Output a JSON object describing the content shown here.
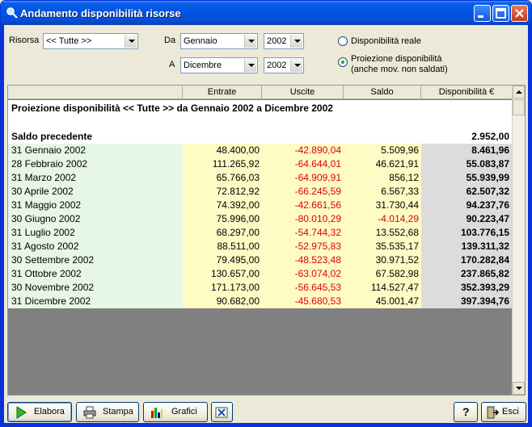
{
  "window": {
    "title": "Andamento disponibilità risorse"
  },
  "filters": {
    "risorsa_label": "Risorsa",
    "risorsa_value": "<< Tutte >>",
    "da_label": "Da",
    "da_month": "Gennaio",
    "da_year": "2002",
    "a_label": "A",
    "a_month": "Dicembre",
    "a_year": "2002",
    "radio_reale": "Disponibilità reale",
    "radio_proiezione_line1": "Proiezione disponibilità",
    "radio_proiezione_line2": "(anche mov. non saldati)",
    "selected": "proiezione"
  },
  "table": {
    "columns": [
      "Entrate",
      "Uscite",
      "Saldo",
      "Disponibilità €"
    ],
    "report_title": "Proiezione disponibilità << Tutte >> da Gennaio 2002 a Dicembre 2002",
    "prev_label": "Saldo precedente",
    "prev_value": "2.952,00",
    "rows": [
      {
        "date": "31 Gennaio 2002",
        "entrate": "48.400,00",
        "uscite": "-42.890,04",
        "saldo": "5.509,96",
        "disp": "8.461,96"
      },
      {
        "date": "28 Febbraio 2002",
        "entrate": "111.265,92",
        "uscite": "-64.644,01",
        "saldo": "46.621,91",
        "disp": "55.083,87"
      },
      {
        "date": "31 Marzo 2002",
        "entrate": "65.766,03",
        "uscite": "-64.909,91",
        "saldo": "856,12",
        "disp": "55.939,99"
      },
      {
        "date": "30 Aprile 2002",
        "entrate": "72.812,92",
        "uscite": "-66.245,59",
        "saldo": "6.567,33",
        "disp": "62.507,32"
      },
      {
        "date": "31 Maggio 2002",
        "entrate": "74.392,00",
        "uscite": "-42.661,56",
        "saldo": "31.730,44",
        "disp": "94.237,76"
      },
      {
        "date": "30 Giugno 2002",
        "entrate": "75.996,00",
        "uscite": "-80.010,29",
        "saldo": "-4.014,29",
        "disp": "90.223,47"
      },
      {
        "date": "31 Luglio 2002",
        "entrate": "68.297,00",
        "uscite": "-54.744,32",
        "saldo": "13.552,68",
        "disp": "103.776,15"
      },
      {
        "date": "31 Agosto 2002",
        "entrate": "88.511,00",
        "uscite": "-52.975,83",
        "saldo": "35.535,17",
        "disp": "139.311,32"
      },
      {
        "date": "30 Settembre 2002",
        "entrate": "79.495,00",
        "uscite": "-48.523,48",
        "saldo": "30.971,52",
        "disp": "170.282,84"
      },
      {
        "date": "31 Ottobre 2002",
        "entrate": "130.657,00",
        "uscite": "-63.074,02",
        "saldo": "67.582,98",
        "disp": "237.865,82"
      },
      {
        "date": "30 Novembre 2002",
        "entrate": "171.173,00",
        "uscite": "-56.645,53",
        "saldo": "114.527,47",
        "disp": "352.393,29"
      },
      {
        "date": "31 Dicembre 2002",
        "entrate": "90.682,00",
        "uscite": "-45.680,53",
        "saldo": "45.001,47",
        "disp": "397.394,76"
      }
    ]
  },
  "buttons": {
    "elabora": "Elabora",
    "stampa": "Stampa",
    "grafici": "Grafici",
    "help": "?",
    "esci": "Esci"
  },
  "colors": {
    "negative": "#e00000",
    "date_bg": "#e6f7e6",
    "value_bg": "#fffbc4",
    "disp_bg": "#dcdcdc"
  }
}
